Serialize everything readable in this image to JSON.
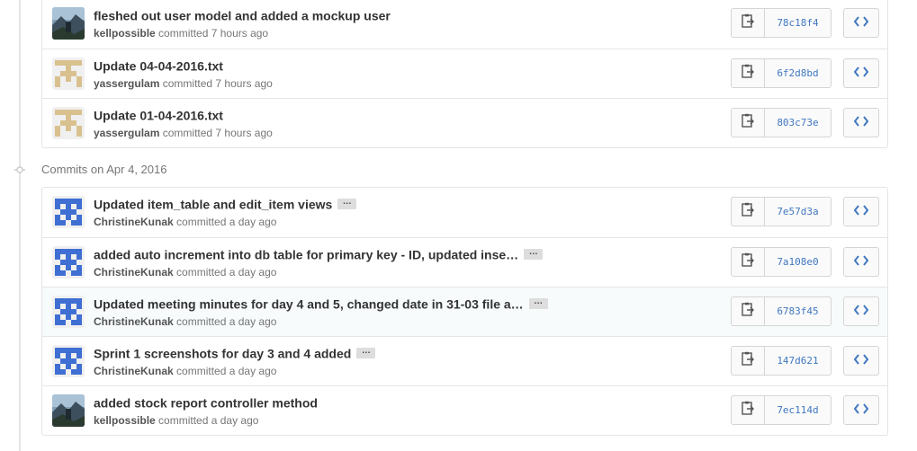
{
  "groups": [
    {
      "commits": [
        {
          "message": "fleshed out user model and added a mockup user",
          "author": "kellpossible",
          "time": "committed 7 hours ago",
          "sha": "78c18f4",
          "avatar": "photo",
          "ellipsis": false
        },
        {
          "message": "Update 04-04-2016.txt",
          "author": "yassergulam",
          "time": "committed 7 hours ago",
          "sha": "6f2d8bd",
          "avatar": "identicon-tan",
          "ellipsis": false
        },
        {
          "message": "Update 01-04-2016.txt",
          "author": "yassergulam",
          "time": "committed 7 hours ago",
          "sha": "803c73e",
          "avatar": "identicon-tan",
          "ellipsis": false
        }
      ]
    },
    {
      "date_label": "Commits on Apr 4, 2016",
      "commits": [
        {
          "message": "Updated item_table and edit_item views",
          "author": "ChristineKunak",
          "time": "committed a day ago",
          "sha": "7e57d3a",
          "avatar": "identicon-blue",
          "ellipsis": true
        },
        {
          "message": "added auto increment into db table for primary key - ID, updated inse…",
          "author": "ChristineKunak",
          "time": "committed a day ago",
          "sha": "7a108e0",
          "avatar": "identicon-blue",
          "ellipsis": true
        },
        {
          "message": "Updated meeting minutes for day 4 and 5, changed date in 31-03 file a…",
          "author": "ChristineKunak",
          "time": "committed a day ago",
          "sha": "6783f45",
          "avatar": "identicon-blue",
          "ellipsis": true
        },
        {
          "message": "Sprint 1 screenshots for day 3 and 4 added",
          "author": "ChristineKunak",
          "time": "committed a day ago",
          "sha": "147d621",
          "avatar": "identicon-blue",
          "ellipsis": true
        },
        {
          "message": "added stock report controller method",
          "author": "kellpossible",
          "time": "committed a day ago",
          "sha": "7ec114d",
          "avatar": "photo",
          "ellipsis": false
        }
      ]
    }
  ],
  "ellipsis_label": "…",
  "icons": {
    "copy": "clipboard-icon",
    "browse": "code-icon",
    "timeline": "commit-dot-icon"
  },
  "colors": {
    "sha": "#4078c0",
    "identicon_blue": "#3f6fd2",
    "identicon_tan": "#d9c18f"
  }
}
